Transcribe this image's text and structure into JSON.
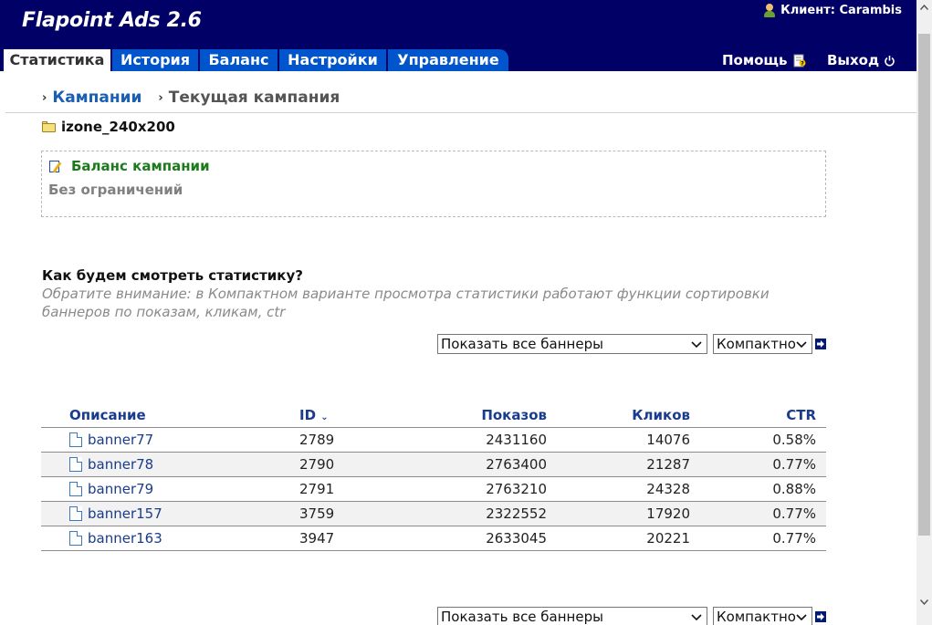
{
  "header": {
    "app_title": "Flapoint Ads 2.6",
    "client_label": "Клиент: Carambis"
  },
  "nav": {
    "tabs": [
      {
        "label": "Статистика",
        "active": true
      },
      {
        "label": "История"
      },
      {
        "label": "Баланс"
      },
      {
        "label": "Настройки"
      },
      {
        "label": "Управление"
      }
    ],
    "help_label": "Помощь",
    "exit_label": "Выход"
  },
  "breadcrumb": {
    "campaigns": "Кампании",
    "current": "Текущая кампания"
  },
  "campaign": {
    "name": "izone_240x200"
  },
  "balance": {
    "title": "Баланс кампании",
    "value": "Без ограничений"
  },
  "view": {
    "question": "Как будем смотреть статистику?",
    "notice": "Обратите внимание: в Компактном варианте просмотра статистики работают функции сортировки баннеров по показам, кликам, ctr",
    "banner_filter": "Показать все баннеры",
    "view_mode": "Компактно"
  },
  "table": {
    "columns": {
      "description": "Описание",
      "id": "ID",
      "shows": "Показов",
      "clicks": "Кликов",
      "ctr": "CTR"
    },
    "rows": [
      {
        "name": "banner77",
        "id": "2789",
        "shows": "2431160",
        "clicks": "14076",
        "ctr": "0.58%"
      },
      {
        "name": "banner78",
        "id": "2790",
        "shows": "2763400",
        "clicks": "21287",
        "ctr": "0.77%"
      },
      {
        "name": "banner79",
        "id": "2791",
        "shows": "2763210",
        "clicks": "24328",
        "ctr": "0.88%"
      },
      {
        "name": "banner157",
        "id": "3759",
        "shows": "2322552",
        "clicks": "17920",
        "ctr": "0.77%"
      },
      {
        "name": "banner163",
        "id": "3947",
        "shows": "2633045",
        "clicks": "20221",
        "ctr": "0.77%"
      }
    ]
  },
  "colors": {
    "header_bg": "#000066",
    "tab_bg": "#0055cc",
    "link": "#1a3c8c",
    "balance_title": "#1c7a1c"
  }
}
